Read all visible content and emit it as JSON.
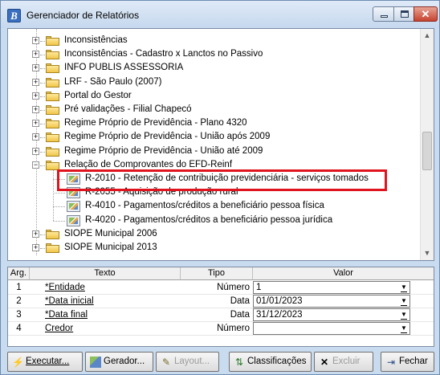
{
  "window": {
    "title": "Gerenciador de Relatórios",
    "icon_letter": "B"
  },
  "tree": {
    "items": [
      {
        "label": "Inconsistências",
        "type": "folder",
        "expand": "+"
      },
      {
        "label": "Inconsistências - Cadastro x Lanctos no Passivo",
        "type": "folder",
        "expand": "+"
      },
      {
        "label": "INFO PUBLIS ASSESSORIA",
        "type": "folder",
        "expand": "+"
      },
      {
        "label": "LRF - São Paulo (2007)",
        "type": "folder",
        "expand": "+"
      },
      {
        "label": "Portal do Gestor",
        "type": "folder",
        "expand": "+"
      },
      {
        "label": "Pré validações - Filial Chapecó",
        "type": "folder",
        "expand": "+"
      },
      {
        "label": "Regime Próprio de Previdência - Plano 4320",
        "type": "folder",
        "expand": "+"
      },
      {
        "label": "Regime Próprio de Previdência - União após 2009",
        "type": "folder",
        "expand": "+"
      },
      {
        "label": "Regime Próprio de Previdência - União até 2009",
        "type": "folder",
        "expand": "+"
      },
      {
        "label": "Relação de Comprovantes do EFD-Reinf",
        "type": "folder",
        "expand": "−"
      },
      {
        "label": "R-2010 - Retenção de contribuição previdenciária - serviços tomados",
        "type": "report"
      },
      {
        "label": "R-2055 - Aquisição de produção rural",
        "type": "report"
      },
      {
        "label": "R-4010 - Pagamentos/créditos a beneficiário pessoa física",
        "type": "report"
      },
      {
        "label": "R-4020 - Pagamentos/créditos a beneficiário pessoa jurídica",
        "type": "report"
      },
      {
        "label": "SIOPE Municipal 2006",
        "type": "folder",
        "expand": "+"
      },
      {
        "label": "SIOPE Municipal 2013",
        "type": "folder",
        "expand": "+"
      }
    ]
  },
  "grid": {
    "headers": [
      "Arg.",
      "Texto",
      "Tipo",
      "Valor"
    ],
    "rows": [
      {
        "arg": "1",
        "texto": "*Entidade",
        "tipo": "Número",
        "valor": "1"
      },
      {
        "arg": "2",
        "texto": "*Data inicial",
        "tipo": "Data",
        "valor": "01/01/2023"
      },
      {
        "arg": "3",
        "texto": "*Data final",
        "tipo": "Data",
        "valor": "31/12/2023"
      },
      {
        "arg": "4",
        "texto": "Credor",
        "tipo": "Número",
        "valor": ""
      }
    ]
  },
  "toolbar": {
    "executar": "Executar...",
    "gerador": "Gerador...",
    "layout": "Layout...",
    "classificacoes": "Classificações",
    "excluir": "Excluir",
    "fechar": "Fechar"
  }
}
